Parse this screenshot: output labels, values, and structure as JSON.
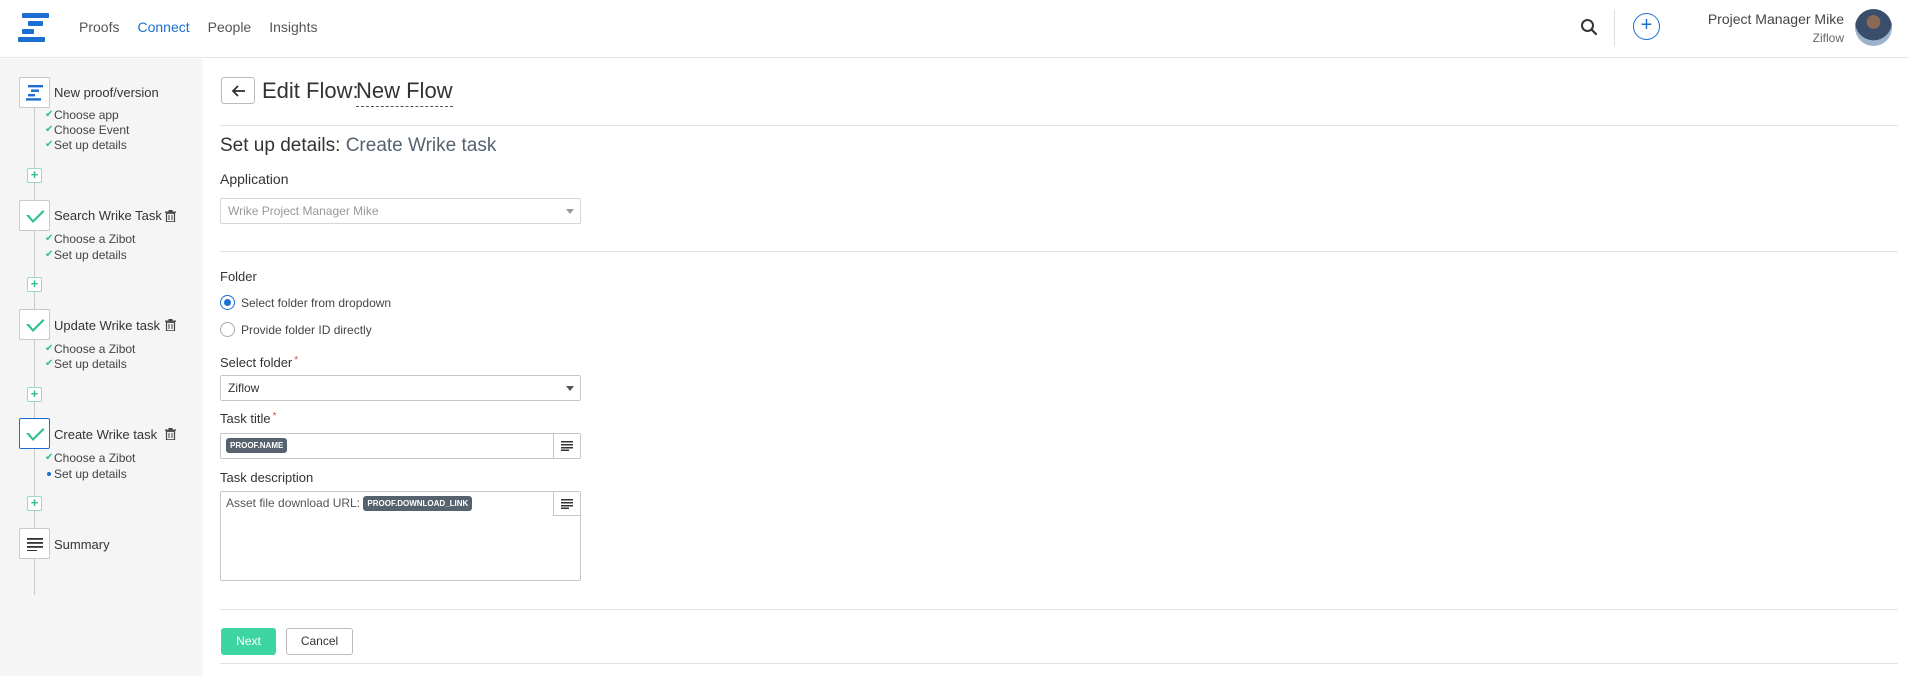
{
  "nav": {
    "items": [
      "Proofs",
      "Connect",
      "People",
      "Insights"
    ],
    "active": "Connect"
  },
  "user": {
    "name": "Project Manager Mike",
    "org": "Ziflow"
  },
  "colors": {
    "brand": "#1b6fd3",
    "success": "#2fbf8f",
    "next_button": "#3dd6a3",
    "tag": "#56636e"
  },
  "sidebar": {
    "steps": [
      {
        "title": "New proof/version",
        "icon": "ziflow-logo-icon",
        "subs": [
          "Choose app",
          "Choose Event",
          "Set up details"
        ]
      },
      {
        "title": "Search Wrike Task",
        "icon": "wrike-check-icon",
        "subs": [
          "Choose a Zibot",
          "Set up details"
        ]
      },
      {
        "title": "Update Wrike task",
        "icon": "wrike-check-icon",
        "subs": [
          "Choose a Zibot",
          "Set up details"
        ]
      },
      {
        "title": "Create Wrike task",
        "icon": "wrike-check-icon",
        "subs": [
          "Choose a Zibot",
          "Set up details"
        ]
      },
      {
        "title": "Summary",
        "icon": "list-icon",
        "subs": []
      }
    ]
  },
  "header": {
    "edit_label": "Edit Flow:",
    "flow_name": "New Flow"
  },
  "setup": {
    "prefix": "Set up details:",
    "name": "Create Wrike task"
  },
  "application": {
    "label": "Application",
    "value": "Wrike Project Manager Mike"
  },
  "folder": {
    "label": "Folder",
    "options": [
      "Select folder from dropdown",
      "Provide folder ID directly"
    ],
    "selected_option": "Select folder from dropdown"
  },
  "select_folder": {
    "label": "Select folder",
    "required_mark": "*",
    "value": "Ziflow"
  },
  "task_title": {
    "label": "Task title",
    "required_mark": "*",
    "tag": "PROOF.NAME"
  },
  "task_description": {
    "label": "Task description",
    "text": "Asset file download URL:",
    "tag": "PROOF.DOWNLOAD_LINK"
  },
  "actions": {
    "next": "Next",
    "cancel": "Cancel"
  }
}
